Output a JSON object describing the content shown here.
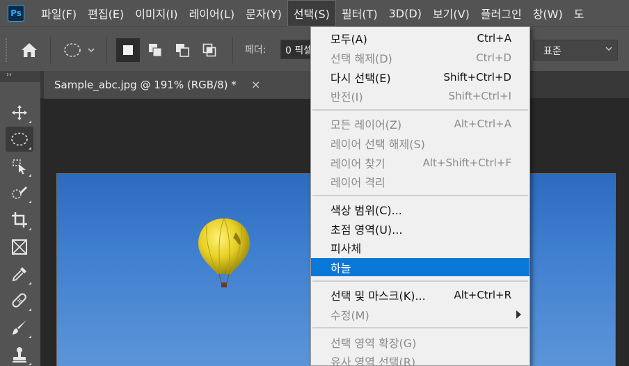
{
  "app": {
    "logo_text": "Ps"
  },
  "menubar": {
    "items": [
      "파일(F)",
      "편집(E)",
      "이미지(I)",
      "레이어(L)",
      "문자(Y)",
      "선택(S)",
      "필터(T)",
      "3D(D)",
      "보기(V)",
      "플러그인",
      "창(W)",
      "도"
    ],
    "active_index": 5
  },
  "options": {
    "feather_label": "페더:",
    "feather_value": "0 픽셀",
    "style_value": "표준"
  },
  "toolbar": {
    "collapse": "››",
    "tools": [
      "move-icon",
      "elliptical-marquee-icon",
      "object-selection-icon",
      "quick-selection-icon",
      "crop-icon",
      "frame-icon",
      "eyedropper-icon",
      "spot-healing-icon",
      "brush-icon",
      "clone-stamp-icon"
    ],
    "active_tool": "elliptical-marquee-icon"
  },
  "document": {
    "tab_title": "Sample_abc.jpg @ 191% (RGB/8) *",
    "close_glyph": "×"
  },
  "select_menu": {
    "items": [
      {
        "label": "모두(A)",
        "shortcut": "Ctrl+A",
        "disabled": false
      },
      {
        "label": "선택 해제(D)",
        "shortcut": "Ctrl+D",
        "disabled": true
      },
      {
        "label": "다시 선택(E)",
        "shortcut": "Shift+Ctrl+D",
        "disabled": false
      },
      {
        "label": "반전(I)",
        "shortcut": "Shift+Ctrl+I",
        "disabled": true
      },
      {
        "label": "모든 레이어(Z)",
        "shortcut": "Alt+Ctrl+A",
        "disabled": true
      },
      {
        "label": "레이어 선택 해제(S)",
        "shortcut": "",
        "disabled": true
      },
      {
        "label": "레이어 찾기",
        "shortcut": "Alt+Shift+Ctrl+F",
        "disabled": true
      },
      {
        "label": "레이어 격리",
        "shortcut": "",
        "disabled": true
      },
      {
        "label": "색상 범위(C)...",
        "shortcut": "",
        "disabled": false
      },
      {
        "label": "초점 영역(U)...",
        "shortcut": "",
        "disabled": false
      },
      {
        "label": "피사체",
        "shortcut": "",
        "disabled": false
      },
      {
        "label": "하늘",
        "shortcut": "",
        "disabled": false,
        "highlighted": true
      },
      {
        "label": "선택 및 마스크(K)...",
        "shortcut": "Alt+Ctrl+R",
        "disabled": false
      },
      {
        "label": "수정(M)",
        "shortcut": "",
        "disabled": true,
        "submenu": true
      },
      {
        "label": "선택 영역 확장(G)",
        "shortcut": "",
        "disabled": true
      },
      {
        "label": "유사 영역 선택(R)",
        "shortcut": "",
        "disabled": true
      }
    ]
  },
  "colors": {
    "highlight": "#0a78d7",
    "menubar": "#535353",
    "sky": "#3f7fd0"
  }
}
